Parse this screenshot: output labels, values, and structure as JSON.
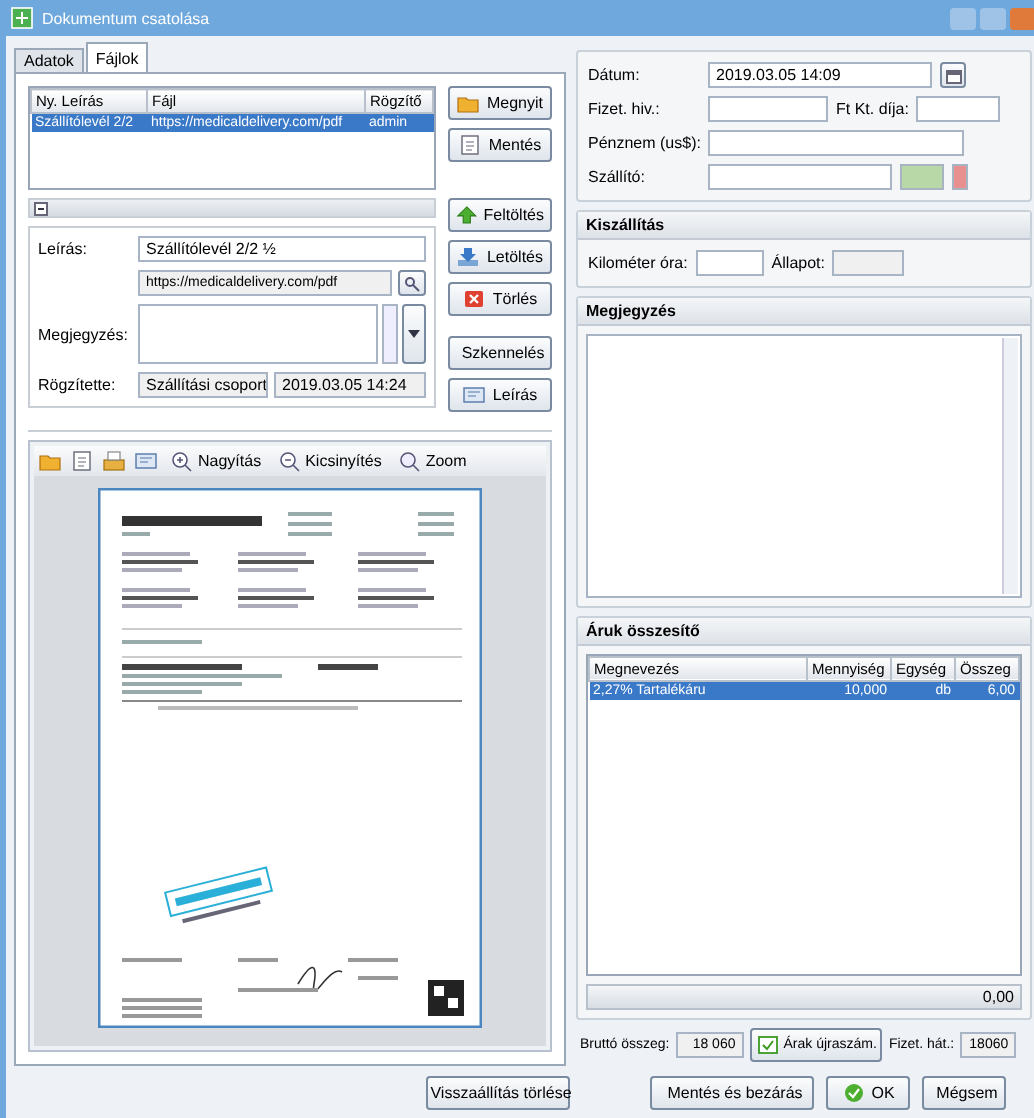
{
  "window": {
    "title": "Dokumentum csatolása"
  },
  "tabs": [
    {
      "label": "Adatok",
      "selected": false
    },
    {
      "label": "Fájlok",
      "selected": true
    }
  ],
  "files": {
    "columns": [
      "Ny. Leírás",
      "Fájl",
      "Rögzítő"
    ],
    "rows": [
      {
        "cells": [
          "Szállítólevél 2/2",
          "https://medicaldelivery.com/pdf",
          "admin"
        ],
        "selected": true
      }
    ]
  },
  "file_buttons": [
    {
      "label": "Megnyit",
      "kind": "open"
    },
    {
      "label": "Mentés",
      "kind": "save"
    }
  ],
  "detail": {
    "description_label": "Leírás:",
    "description": "Szállítólevél 2/2 ½",
    "url": "https://medicaldelivery.com/pdf",
    "note_label": "Megjegyzés:",
    "recorder_label": "Rögzítette:",
    "recorder": "Szállítási csoport",
    "date": "2019.03.05 14:24"
  },
  "action_buttons": [
    {
      "label": "Feltöltés",
      "kind": "upload"
    },
    {
      "label": "Letöltés",
      "kind": "download"
    },
    {
      "label": "Törlés",
      "kind": "delete"
    },
    {
      "label": "Szkennelés",
      "kind": "scan"
    },
    {
      "label": "Leírás",
      "kind": "describe"
    }
  ],
  "viewer_toolbar": [
    {
      "label": "Nagyítás",
      "kind": "zoom-in"
    },
    {
      "label": "Kicsinyítés",
      "kind": "zoom-out"
    },
    {
      "label": "Zoom",
      "kind": "zoom"
    }
  ],
  "header_fields": {
    "date_label": "Dátum:",
    "date": "2019.03.05 14:09",
    "pay_label": "Fizet. hiv.:",
    "fee_label": "Ft Kt. díja:",
    "amount_label": "Pénznem (us$):",
    "ref_label": "Szállító:"
  },
  "delivery": {
    "title": "Kiszállítás",
    "km_label": "Kilométer óra:",
    "status_label": "Állapot:"
  },
  "notes": {
    "title": "Megjegyzés"
  },
  "items": {
    "title": "Áruk összesítő",
    "columns": [
      "Megnevezés",
      "Mennyiség",
      "Egység",
      "Összeg"
    ],
    "rows": [
      {
        "cells": [
          "2,27% Tartalékáru",
          "10,000",
          "db",
          "6,00"
        ],
        "selected": true
      }
    ],
    "total": "0,00"
  },
  "summary": {
    "gross_label": "Bruttó összeg:",
    "gross": "18 060",
    "recalc_button": "Árak újraszám.",
    "pay_label": "Fizet. hát.:",
    "pay": "18060"
  },
  "footer_buttons": [
    {
      "label": "Visszaállítás törlése",
      "kind": "delete"
    },
    {
      "label": "Mentés és bezárás",
      "kind": "save-close"
    },
    {
      "label": "OK",
      "kind": "ok"
    },
    {
      "label": "Mégsem",
      "kind": "cancel"
    }
  ]
}
